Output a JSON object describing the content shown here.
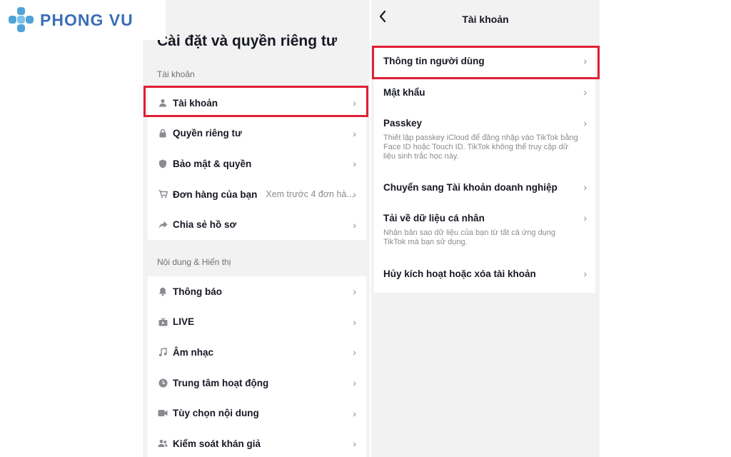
{
  "watermark": {
    "brand_text": "PHONG VU",
    "color": "#3a6fb6",
    "mark_color": "#4fa3d9"
  },
  "left_screen": {
    "title": "Cài đặt và quyền riêng tư",
    "sections": [
      {
        "label": "Tài khoản",
        "items": [
          {
            "label": "Tài khoản",
            "icon": "person-icon",
            "highlighted": true
          },
          {
            "label": "Quyền riêng tư",
            "icon": "lock-icon"
          },
          {
            "label": "Bảo mật & quyền",
            "icon": "shield-icon"
          },
          {
            "label": "Đơn hàng của bạn",
            "icon": "cart-icon",
            "detail": "Xem trước 4 đơn hà..."
          },
          {
            "label": "Chia sẻ hồ sơ",
            "icon": "share-arrow-icon"
          }
        ]
      },
      {
        "label": "Nội dung & Hiển thị",
        "items": [
          {
            "label": "Thông báo",
            "icon": "bell-icon"
          },
          {
            "label": "LIVE",
            "icon": "tv-icon"
          },
          {
            "label": "Âm nhạc",
            "icon": "music-note-icon"
          },
          {
            "label": "Trung tâm hoạt động",
            "icon": "clock-icon"
          },
          {
            "label": "Tùy chọn nội dung",
            "icon": "video-camera-icon"
          },
          {
            "label": "Kiểm soát khán giả",
            "icon": "people-icon"
          }
        ]
      }
    ]
  },
  "right_screen": {
    "title": "Tài khoản",
    "back_icon": "chevron-left-icon",
    "items": [
      {
        "label": "Thông tin người dùng",
        "highlighted": true
      },
      {
        "label": "Mật khẩu"
      },
      {
        "label": "Passkey",
        "description": "Thiết lập passkey iCloud để đăng nhập vào TikTok bằng Face ID hoặc Touch ID. TikTok không thể truy cập dữ liệu sinh trắc học này."
      },
      {
        "label": "Chuyển sang Tài khoản doanh nghiệp"
      },
      {
        "label": "Tải về dữ liệu cá nhân",
        "description": "Nhận bản sao dữ liệu của bạn từ tất cả ứng dụng TikTok mà bạn sử dụng."
      },
      {
        "label": "Hủy kích hoạt hoặc xóa tài khoản"
      }
    ]
  },
  "colors": {
    "highlight": "#e01f35",
    "panel_bg": "#f2f2f2",
    "text": "#161823",
    "muted": "#8a8b91"
  }
}
